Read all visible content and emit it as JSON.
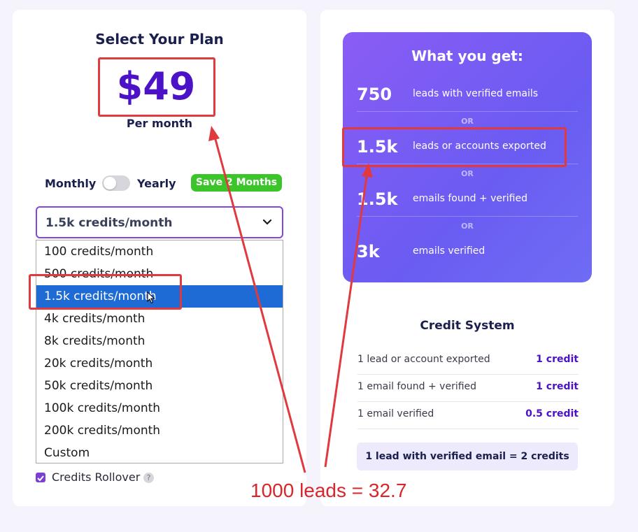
{
  "plan": {
    "title": "Select Your Plan",
    "price": "$49",
    "per_month": "Per month"
  },
  "billing": {
    "monthly_label": "Monthly",
    "yearly_label": "Yearly",
    "save_badge": "Save 2 Months",
    "yearly_enabled": false
  },
  "credits_select": {
    "value": "1.5k credits/month",
    "options": [
      "100 credits/month",
      "500 credits/month",
      "1.5k credits/month",
      "4k credits/month",
      "8k credits/month",
      "20k credits/month",
      "50k credits/month",
      "100k credits/month",
      "200k credits/month",
      "Custom"
    ],
    "highlighted_index": 2
  },
  "rollover": {
    "label": "Credits Rollover",
    "checked": true,
    "help": "?"
  },
  "what_you_get": {
    "title": "What you get:",
    "or_label": "OR",
    "items": [
      {
        "num": "750",
        "desc": "leads with verified emails"
      },
      {
        "num": "1.5k",
        "desc": "leads or accounts exported"
      },
      {
        "num": "1.5k",
        "desc": "emails found + verified"
      },
      {
        "num": "3k",
        "desc": "emails verified"
      }
    ]
  },
  "credit_system": {
    "title": "Credit System",
    "rows": [
      {
        "label": "1 lead or account exported",
        "value": "1 credit"
      },
      {
        "label": "1 email found + verified",
        "value": "1 credit"
      },
      {
        "label": "1 email verified",
        "value": "0.5 credit"
      }
    ],
    "note": "1 lead with verified email = 2 credits"
  },
  "annotation": {
    "text": "1000 leads = 32.7"
  },
  "colors": {
    "accent": "#4b12c8",
    "save_green": "#3bc52b",
    "highlight_blue": "#1f6bd6",
    "annotation_red": "#e0393e"
  }
}
